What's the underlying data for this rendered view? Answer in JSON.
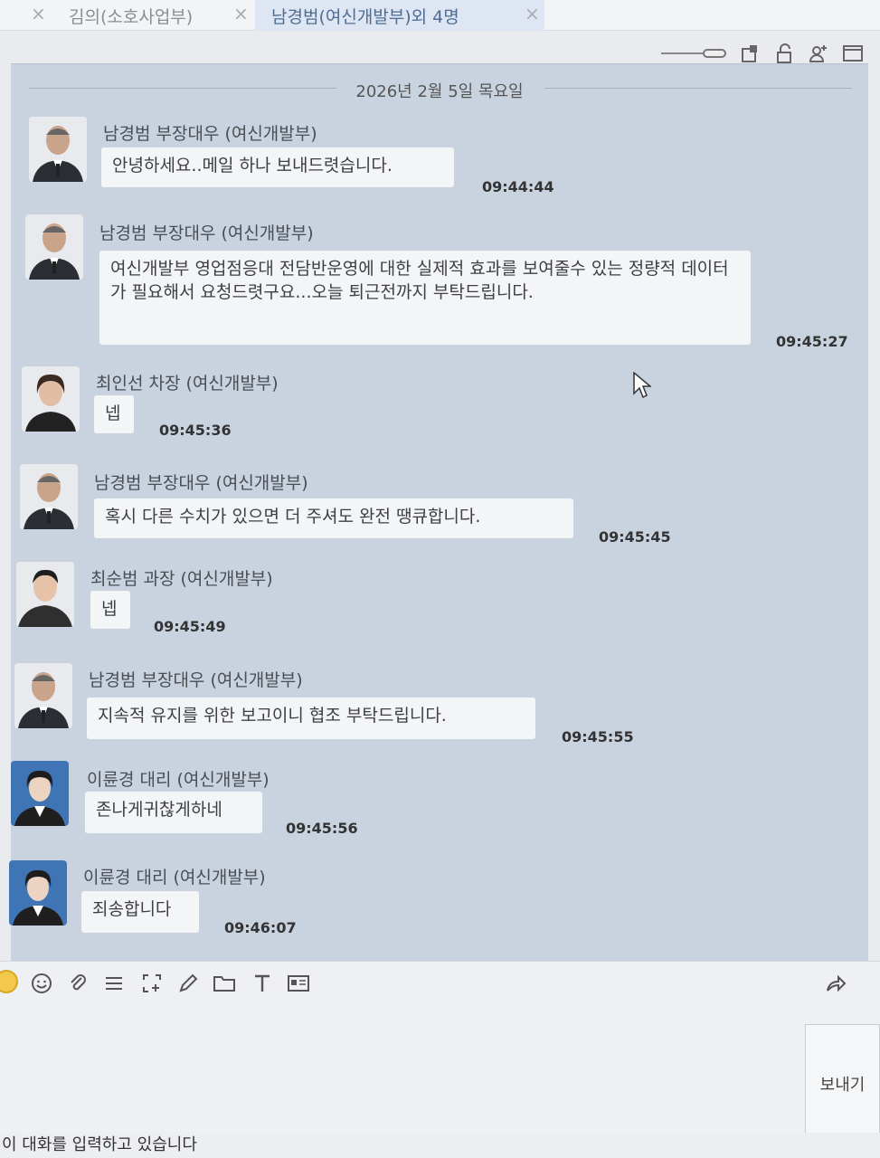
{
  "tabs": [
    {
      "label": "김의(소호사업부)",
      "active": false
    },
    {
      "label": "남경범(여신개발부)외 4명",
      "active": true
    }
  ],
  "date_separator": "2026년 2월 5일 목요일",
  "messages": [
    {
      "sender": "남경범 부장대우 (여신개발부)",
      "text": "안녕하세요..메일 하나 보내드렷습니다.",
      "time": "09:44:44",
      "avatar": "male-suit"
    },
    {
      "sender": "남경범 부장대우 (여신개발부)",
      "text": "여신개발부 영업점응대 전담반운영에 대한 실제적 효과를 보여줄수 있는 정량적 데이터가 필요해서 요청드렷구요...오늘 퇴근전까지 부탁드립니다.",
      "time": "09:45:27",
      "avatar": "male-suit"
    },
    {
      "sender": "최인선 차장 (여신개발부)",
      "text": "넵",
      "time": "09:45:36",
      "avatar": "female"
    },
    {
      "sender": "남경범 부장대우 (여신개발부)",
      "text": "혹시 다른 수치가 있으면 더 주셔도 완전 땡큐합니다.",
      "time": "09:45:45",
      "avatar": "male-suit"
    },
    {
      "sender": "최순범 과장 (여신개발부)",
      "text": "넵",
      "time": "09:45:49",
      "avatar": "male-casual"
    },
    {
      "sender": "남경범 부장대우 (여신개발부)",
      "text": "지속적 유지를 위한 보고이니 협조 부탁드립니다.",
      "time": "09:45:55",
      "avatar": "male-suit"
    },
    {
      "sender": "이륜경 대리 (여신개발부)",
      "text": "존나게귀찮게하네",
      "time": "09:45:56",
      "avatar": "female-blue"
    },
    {
      "sender": "이륜경 대리 (여신개발부)",
      "text": "죄송합니다",
      "time": "09:46:07",
      "avatar": "female-blue"
    }
  ],
  "composer": {
    "send_label": "보내기",
    "status_text": "이 대화를 입력하고 있습니다"
  },
  "icons": {
    "toolbar_top": [
      "zoom-slider",
      "phone-book-icon",
      "lock-icon",
      "add-user-icon",
      "window-icon"
    ],
    "composer": [
      "emoji-icon",
      "smiley-icon",
      "attach-icon",
      "list-icon",
      "capture-icon",
      "pen-icon",
      "folder-icon",
      "text-icon",
      "card-icon",
      "share-icon"
    ]
  }
}
